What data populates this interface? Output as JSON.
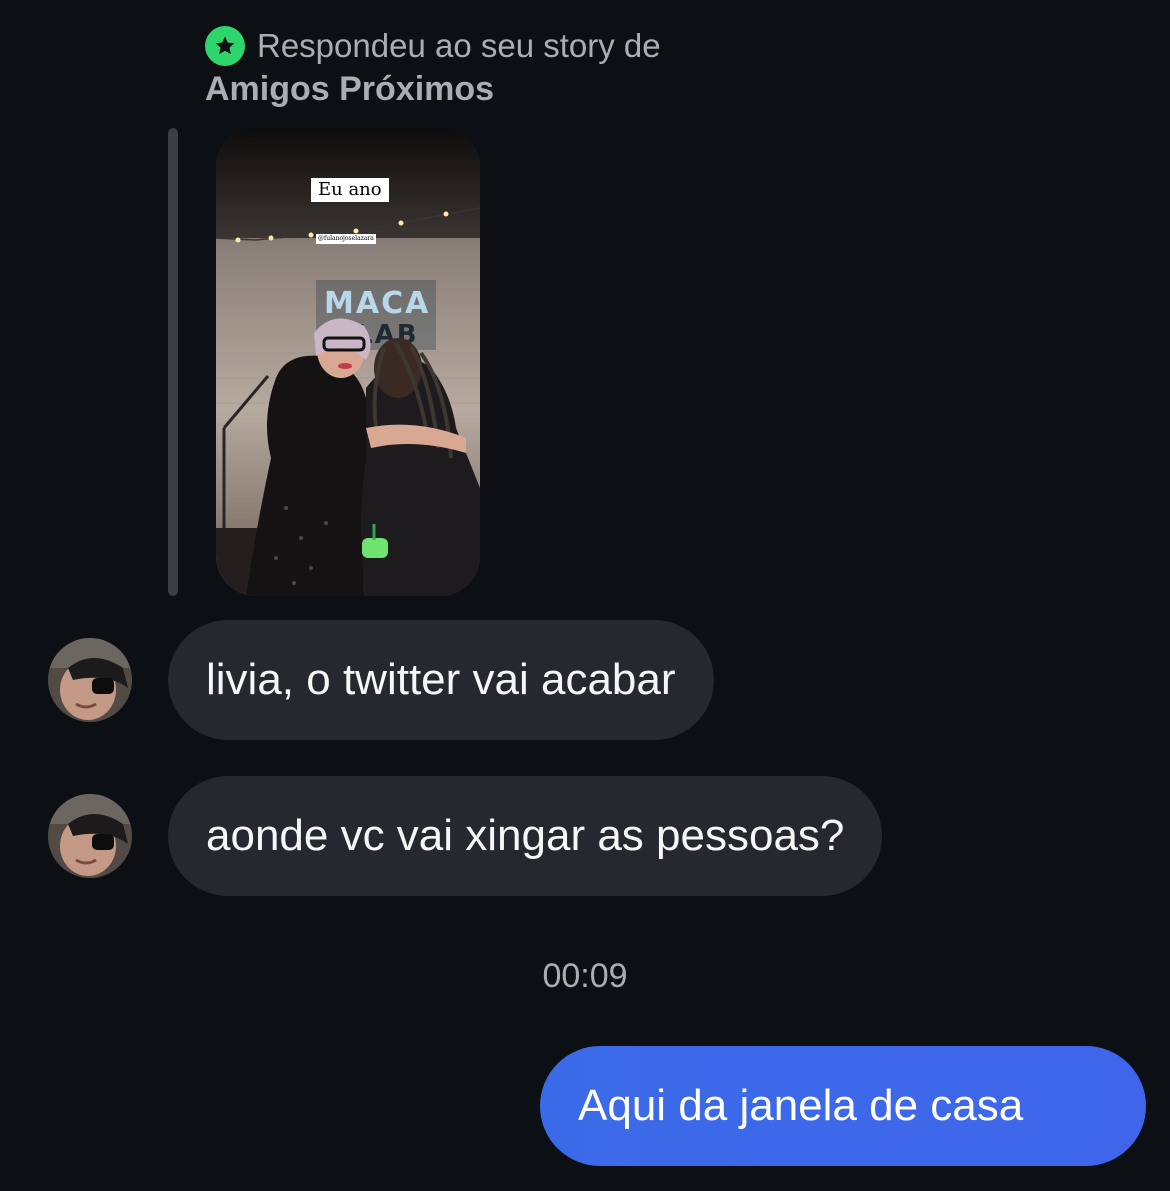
{
  "story_reply": {
    "label": "Respondeu ao seu story de",
    "audience": "Amigos Próximos",
    "badge_icon": "star-icon",
    "badge_color": "#2dd56b",
    "story": {
      "caption": "Eu ano",
      "mention": "@fulanojoselazara",
      "sign_text": "MACA LAB"
    }
  },
  "messages": [
    {
      "direction": "incoming",
      "text": "livia, o twitter vai acabar"
    },
    {
      "direction": "incoming",
      "text": "aonde vc vai xingar as pessoas?"
    }
  ],
  "timestamp": "00:09",
  "outgoing": {
    "direction": "outgoing",
    "text": "Aqui da janela de casa"
  },
  "colors": {
    "background": "#0c0f14",
    "incoming_bubble": "#25282e",
    "outgoing_bubble": "#3b6ae8",
    "muted_text": "#a9adb5"
  }
}
